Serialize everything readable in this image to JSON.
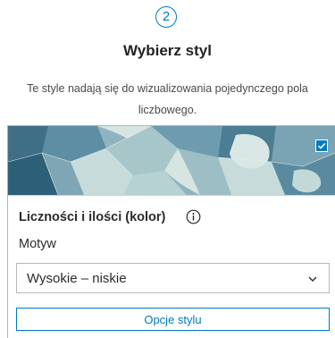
{
  "step": {
    "number": "2"
  },
  "heading": {
    "title": "Wybierz styl",
    "description_line1": "Te style nadają się do wizualizowania pojedynczego pola",
    "description_line2": "liczbowego."
  },
  "style_card": {
    "selected": true,
    "title": "Liczności i ilości (kolor)",
    "theme_label": "Motyw",
    "theme_value": "Wysokie – niskie",
    "options_button": "Opcje stylu"
  },
  "colors": {
    "accent": "#007ac2",
    "map_dark": "#2c5f78",
    "map_mid": "#6e9cae",
    "map_light": "#c7dcda"
  },
  "icons": {
    "info": "info-icon",
    "check": "check-icon",
    "chevron": "chevron-down-icon"
  }
}
